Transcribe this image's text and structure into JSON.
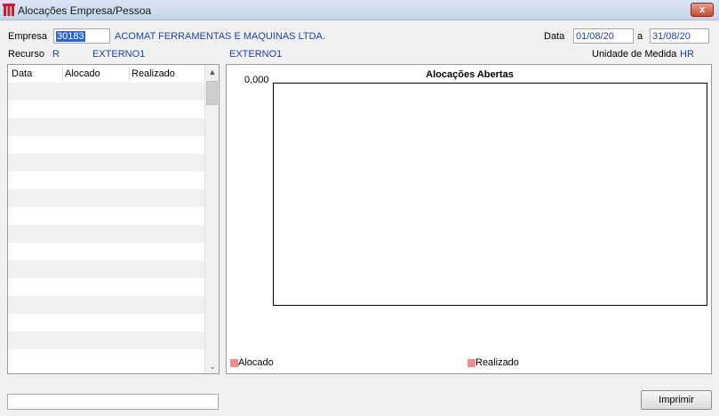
{
  "window": {
    "title": "Alocações Empresa/Pessoa",
    "close_glyph": "x"
  },
  "header": {
    "empresa_label": "Empresa",
    "empresa_code": "30183",
    "empresa_name": "ACOMAT FERRAMENTAS E MAQUINAS LTDA.",
    "data_label": "Data",
    "date_from": "01/08/20",
    "date_sep": "a",
    "date_to": "31/08/20",
    "recurso_label": "Recurso",
    "recurso_code": "R",
    "recurso_name": "EXTERNO1",
    "recurso_name2": "EXTERNO1",
    "unidade_label": "Unidade de Medida",
    "unidade_value": "HR"
  },
  "table": {
    "columns": [
      "Data",
      "Alocado",
      "Realizado"
    ],
    "row_count": 16
  },
  "chart_data": {
    "type": "bar",
    "title": "Alocações Abertas",
    "categories": [],
    "series": [
      {
        "name": "Alocado",
        "values": []
      },
      {
        "name": "Realizado",
        "values": []
      }
    ],
    "y_ticks": [
      "0,000"
    ],
    "legend": [
      "Alocado",
      "Realizado"
    ],
    "legend_color": "#f08c8c",
    "legend_position": "bottom"
  },
  "footer": {
    "status_text": "",
    "print_label": "Imprimir"
  }
}
